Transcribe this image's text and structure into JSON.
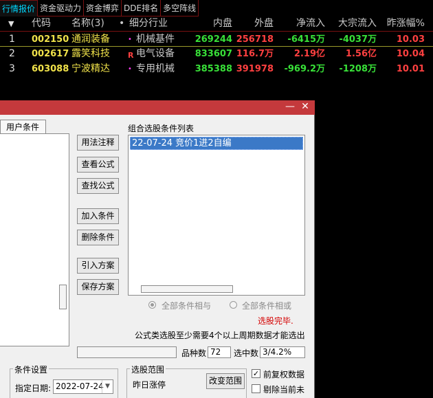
{
  "tabs": [
    "行情报价",
    "资金驱动力",
    "资金博弈",
    "DDE排名",
    "多空阵线"
  ],
  "quote": {
    "headers": {
      "sort_arrow": "▼",
      "code": "代码",
      "name": "名称(3)",
      "dot": "•",
      "industry": "细分行业",
      "inner": "内盘",
      "outer": "外盘",
      "net_inflow": "净流入",
      "block_inflow": "大宗流入",
      "prev_change": "昨涨幅%"
    },
    "rows": [
      {
        "idx": "1",
        "code": "002150",
        "name": "通润装备",
        "mark": "•",
        "industry": "机械基件",
        "inner": "269244",
        "outer": "256718",
        "net": "-6415万",
        "block": "-4037万",
        "pct": "10.03"
      },
      {
        "idx": "2",
        "code": "002617",
        "name": "露笑科技",
        "mark": "R",
        "industry": "电气设备",
        "inner": "833607",
        "outer": "116.7万",
        "net": "2.19亿",
        "block": "1.56亿",
        "pct": "10.04"
      },
      {
        "idx": "3",
        "code": "603088",
        "name": "宁波精达",
        "mark": "•",
        "industry": "专用机械",
        "inner": "385388",
        "outer": "391978",
        "net": "-969.2万",
        "block": "-1208万",
        "pct": "10.01"
      }
    ]
  },
  "dialog": {
    "min_icon": "—",
    "close_icon": "✕",
    "user_tab": "用户条件",
    "buttons": {
      "usage": "用法注释",
      "view_formula": "查看公式",
      "find_formula": "查找公式",
      "add_condition": "加入条件",
      "delete_condition": "删除条件",
      "import_plan": "引入方案",
      "save_plan": "保存方案",
      "change_range": "改变范围"
    },
    "list_title": "组合选股条件列表",
    "list_items": [
      "22-07-24 竞价1进2自编"
    ],
    "radio_and": "全部条件相与",
    "radio_or": "全部条件相或",
    "status": "选股完毕.",
    "note": "公式类选股至少需要4个以上周期数据才能选出",
    "count_label": "品种数",
    "count_value": "72",
    "selected_label": "选中数",
    "selected_value": "3/4.2%",
    "cond_group": "条件设置",
    "date_label": "指定日期:",
    "date_value": "2022-07-24",
    "range_group": "选股范围",
    "range_value": "昨日涨停",
    "fq_check": "前复权数据",
    "exclude_check": "剔除当前未"
  },
  "colors": {
    "title_bar": "#c4393c",
    "stock_code": "#f0e24a",
    "up_red": "#ff4040",
    "down_green": "#38e038",
    "selection": "#3b79c7"
  }
}
